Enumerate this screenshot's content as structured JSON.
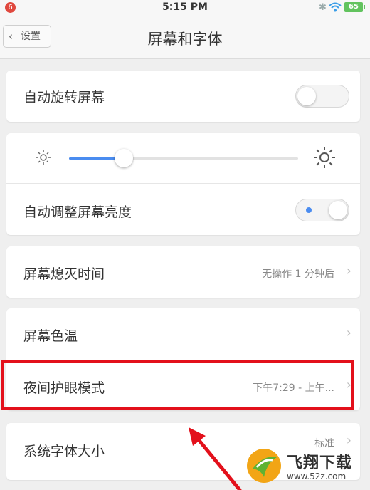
{
  "status_bar": {
    "notification_count": "6",
    "time": "5:15 PM",
    "battery": "65"
  },
  "nav": {
    "back_label": "设置",
    "title": "屏幕和字体"
  },
  "settings": {
    "auto_rotate": {
      "label": "自动旋转屏幕",
      "enabled": false
    },
    "brightness": {
      "level_fraction": 0.24
    },
    "auto_brightness": {
      "label": "自动调整屏幕亮度",
      "enabled": true
    },
    "screen_timeout": {
      "label": "屏幕熄灭时间",
      "value": "无操作 1 分钟后"
    },
    "color_temp": {
      "label": "屏幕色温"
    },
    "night_mode": {
      "label": "夜间护眼模式",
      "value": "下午7:29 - 上午..."
    },
    "font_size": {
      "label": "系统字体大小",
      "value": "标准"
    }
  },
  "watermark": {
    "title": "飞翔下载",
    "url": "www.52z.com"
  },
  "colors": {
    "accent": "#4a8cf0",
    "highlight": "#e3101b",
    "badge": "#e0483e",
    "battery": "#62c35e"
  }
}
